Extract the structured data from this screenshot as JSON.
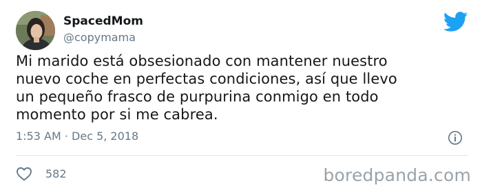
{
  "author": {
    "display_name": "SpacedMom",
    "handle": "@copymama"
  },
  "tweet": {
    "text": "Mi marido está obsesionado con mantener nuestro\nnuevo coche en perfectas condiciones, así que llevo\nun pequeño frasco de purpurina conmigo en todo\nmomento por si me cabrea.",
    "timestamp": "1:53 AM · Dec 5, 2018"
  },
  "engagement": {
    "likes": "582"
  },
  "watermark": "boredpanda.com",
  "icons": {
    "brand": "twitter-bird-icon",
    "info": "info-icon",
    "like": "heart-icon"
  },
  "colors": {
    "twitter_blue": "#1da1f2",
    "secondary_text": "#657786",
    "primary_text": "#14171a",
    "watermark": "#9aa3a9"
  }
}
